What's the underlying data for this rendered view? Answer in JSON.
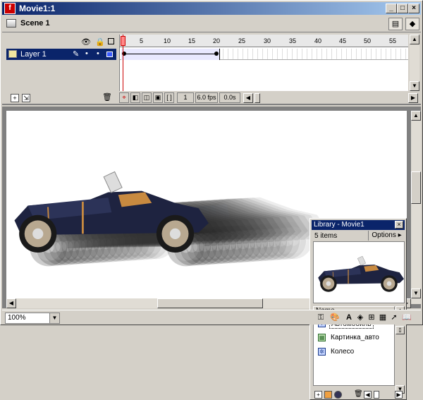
{
  "window": {
    "title": "Movie1:1"
  },
  "scene": {
    "label": "Scene 1"
  },
  "timeline": {
    "layer_name": "Layer 1",
    "ruler_ticks": [
      "1",
      "5",
      "10",
      "15",
      "20",
      "25",
      "30",
      "35",
      "40",
      "45",
      "50",
      "55"
    ],
    "current_frame": "1",
    "fps": "6.0 fps",
    "elapsed": "0.0s"
  },
  "library": {
    "title": "Library - Movie1",
    "item_count": "5 items",
    "options_label": "Options",
    "column_name": "Name",
    "items": [
      {
        "label": "Автомобиль",
        "kind": "symbol",
        "selected": true
      },
      {
        "label": "Картинка_авто",
        "kind": "bitmap",
        "selected": false
      },
      {
        "label": "Колесо",
        "kind": "symbol",
        "selected": false
      }
    ]
  },
  "statusbar": {
    "zoom": "100%"
  },
  "colors": {
    "titlebar": "#0a246a",
    "layer_swatch": "#3b5bff",
    "car_body": "#1e2340"
  }
}
